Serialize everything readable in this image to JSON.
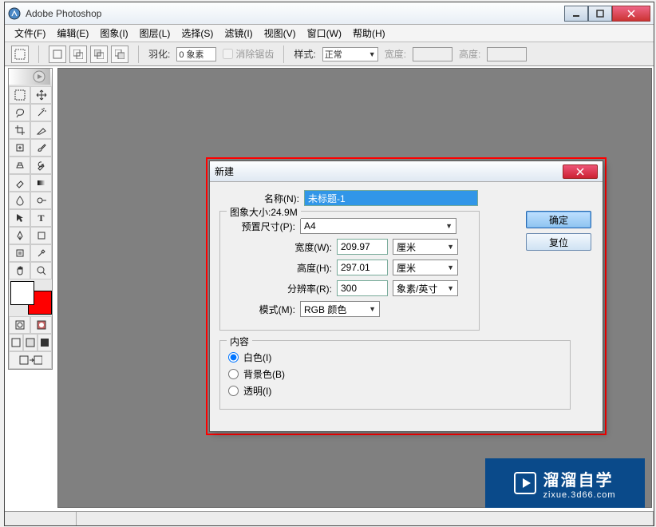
{
  "window": {
    "title": "Adobe Photoshop"
  },
  "menu": {
    "file": "文件(F)",
    "edit": "编辑(E)",
    "image": "图象(I)",
    "layer": "图层(L)",
    "select": "选择(S)",
    "filter": "滤镜(I)",
    "view": "视图(V)",
    "window": "窗口(W)",
    "help": "帮助(H)"
  },
  "optbar": {
    "feather_label": "羽化:",
    "feather_value": "0 象素",
    "antialias": "消除锯齿",
    "style_label": "样式:",
    "style_value": "正常",
    "width_label": "宽度:",
    "height_label": "高度:"
  },
  "dialog": {
    "title": "新建",
    "ok": "确定",
    "reset": "复位",
    "name_label": "名称(N):",
    "name_value": "未标题-1",
    "size_legend": "图象大小:24.9M",
    "preset_label": "预置尺寸(P):",
    "preset_value": "A4",
    "width_label": "宽度(W):",
    "width_value": "209.97",
    "width_unit": "厘米",
    "height_label": "高度(H):",
    "height_value": "297.01",
    "height_unit": "厘米",
    "res_label": "分辨率(R):",
    "res_value": "300",
    "res_unit": "象素/英寸",
    "mode_label": "模式(M):",
    "mode_value": "RGB 颜色",
    "contents_legend": "内容",
    "white": "白色(I)",
    "bg": "背景色(B)",
    "trans": "透明(I)"
  },
  "colors": {
    "fg": "#ffffff",
    "bg": "#ff0000"
  },
  "watermark": {
    "main": "溜溜自学",
    "sub": "zixue.3d66.com"
  }
}
